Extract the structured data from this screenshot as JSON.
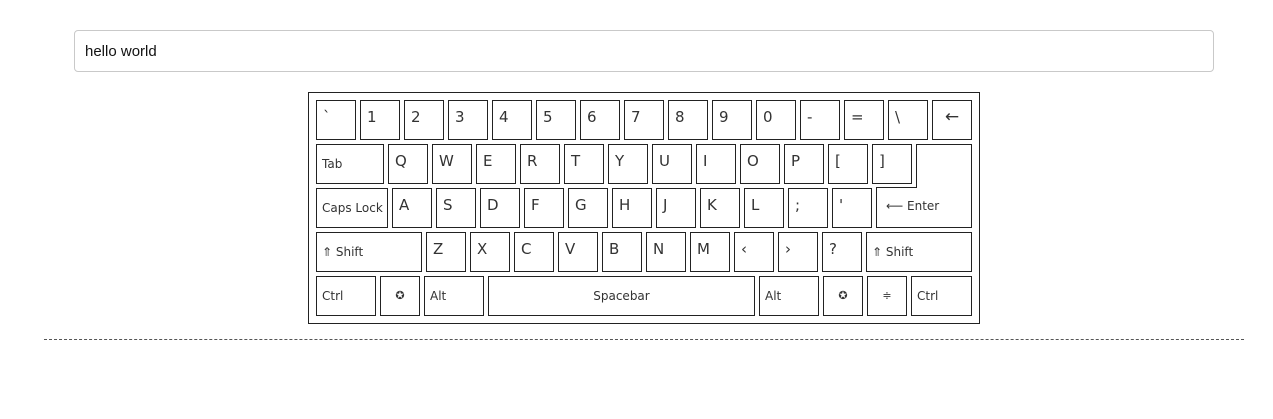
{
  "input": {
    "value": "hello world"
  },
  "keyboard": {
    "row1": [
      "`",
      "1",
      "2",
      "3",
      "4",
      "5",
      "6",
      "7",
      "8",
      "9",
      "0",
      "-",
      "=",
      "\\",
      "←"
    ],
    "row2": [
      "Tab",
      "Q",
      "W",
      "E",
      "R",
      "T",
      "Y",
      "U",
      "I",
      "O",
      "P",
      "[",
      "]"
    ],
    "row3": [
      "Caps Lock",
      "A",
      "S",
      "D",
      "F",
      "G",
      "H",
      "J",
      "K",
      "L",
      ";",
      "'"
    ],
    "enter": "⟵  Enter",
    "row4": [
      "⇑ Shift",
      "Z",
      "X",
      "C",
      "V",
      "B",
      "N",
      "M",
      "‹",
      "›",
      "?",
      "⇑ Shift"
    ],
    "row5": [
      "Ctrl",
      "✪",
      "Alt",
      "Spacebar",
      "Alt",
      "✪",
      "≑",
      "Ctrl"
    ]
  }
}
